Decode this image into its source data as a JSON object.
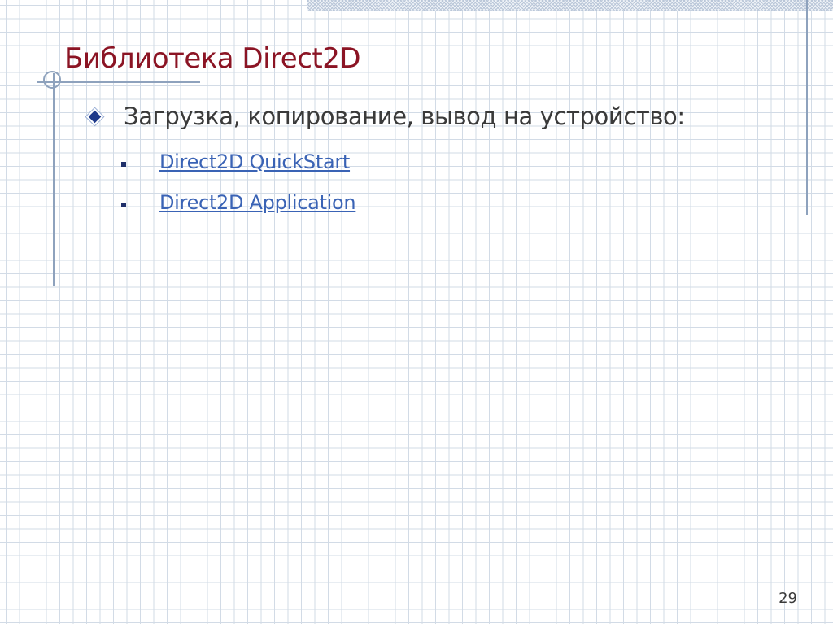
{
  "slide": {
    "title": "Библиотека Direct2D",
    "bullet": "Загрузка, копирование, вывод на устройство:",
    "links": [
      {
        "label": "Direct2D QuickStart"
      },
      {
        "label": "Direct2D Application"
      }
    ],
    "page_number": "29"
  },
  "colors": {
    "title": "#8b1424",
    "body_text": "#3a3a3a",
    "link": "#3a63b5",
    "grid": "#d2dbe6",
    "rule": "#8ea2bd"
  },
  "icons": {
    "level1_bullet": "diamond-bullet-icon",
    "level2_bullet": "square-bullet-icon"
  }
}
